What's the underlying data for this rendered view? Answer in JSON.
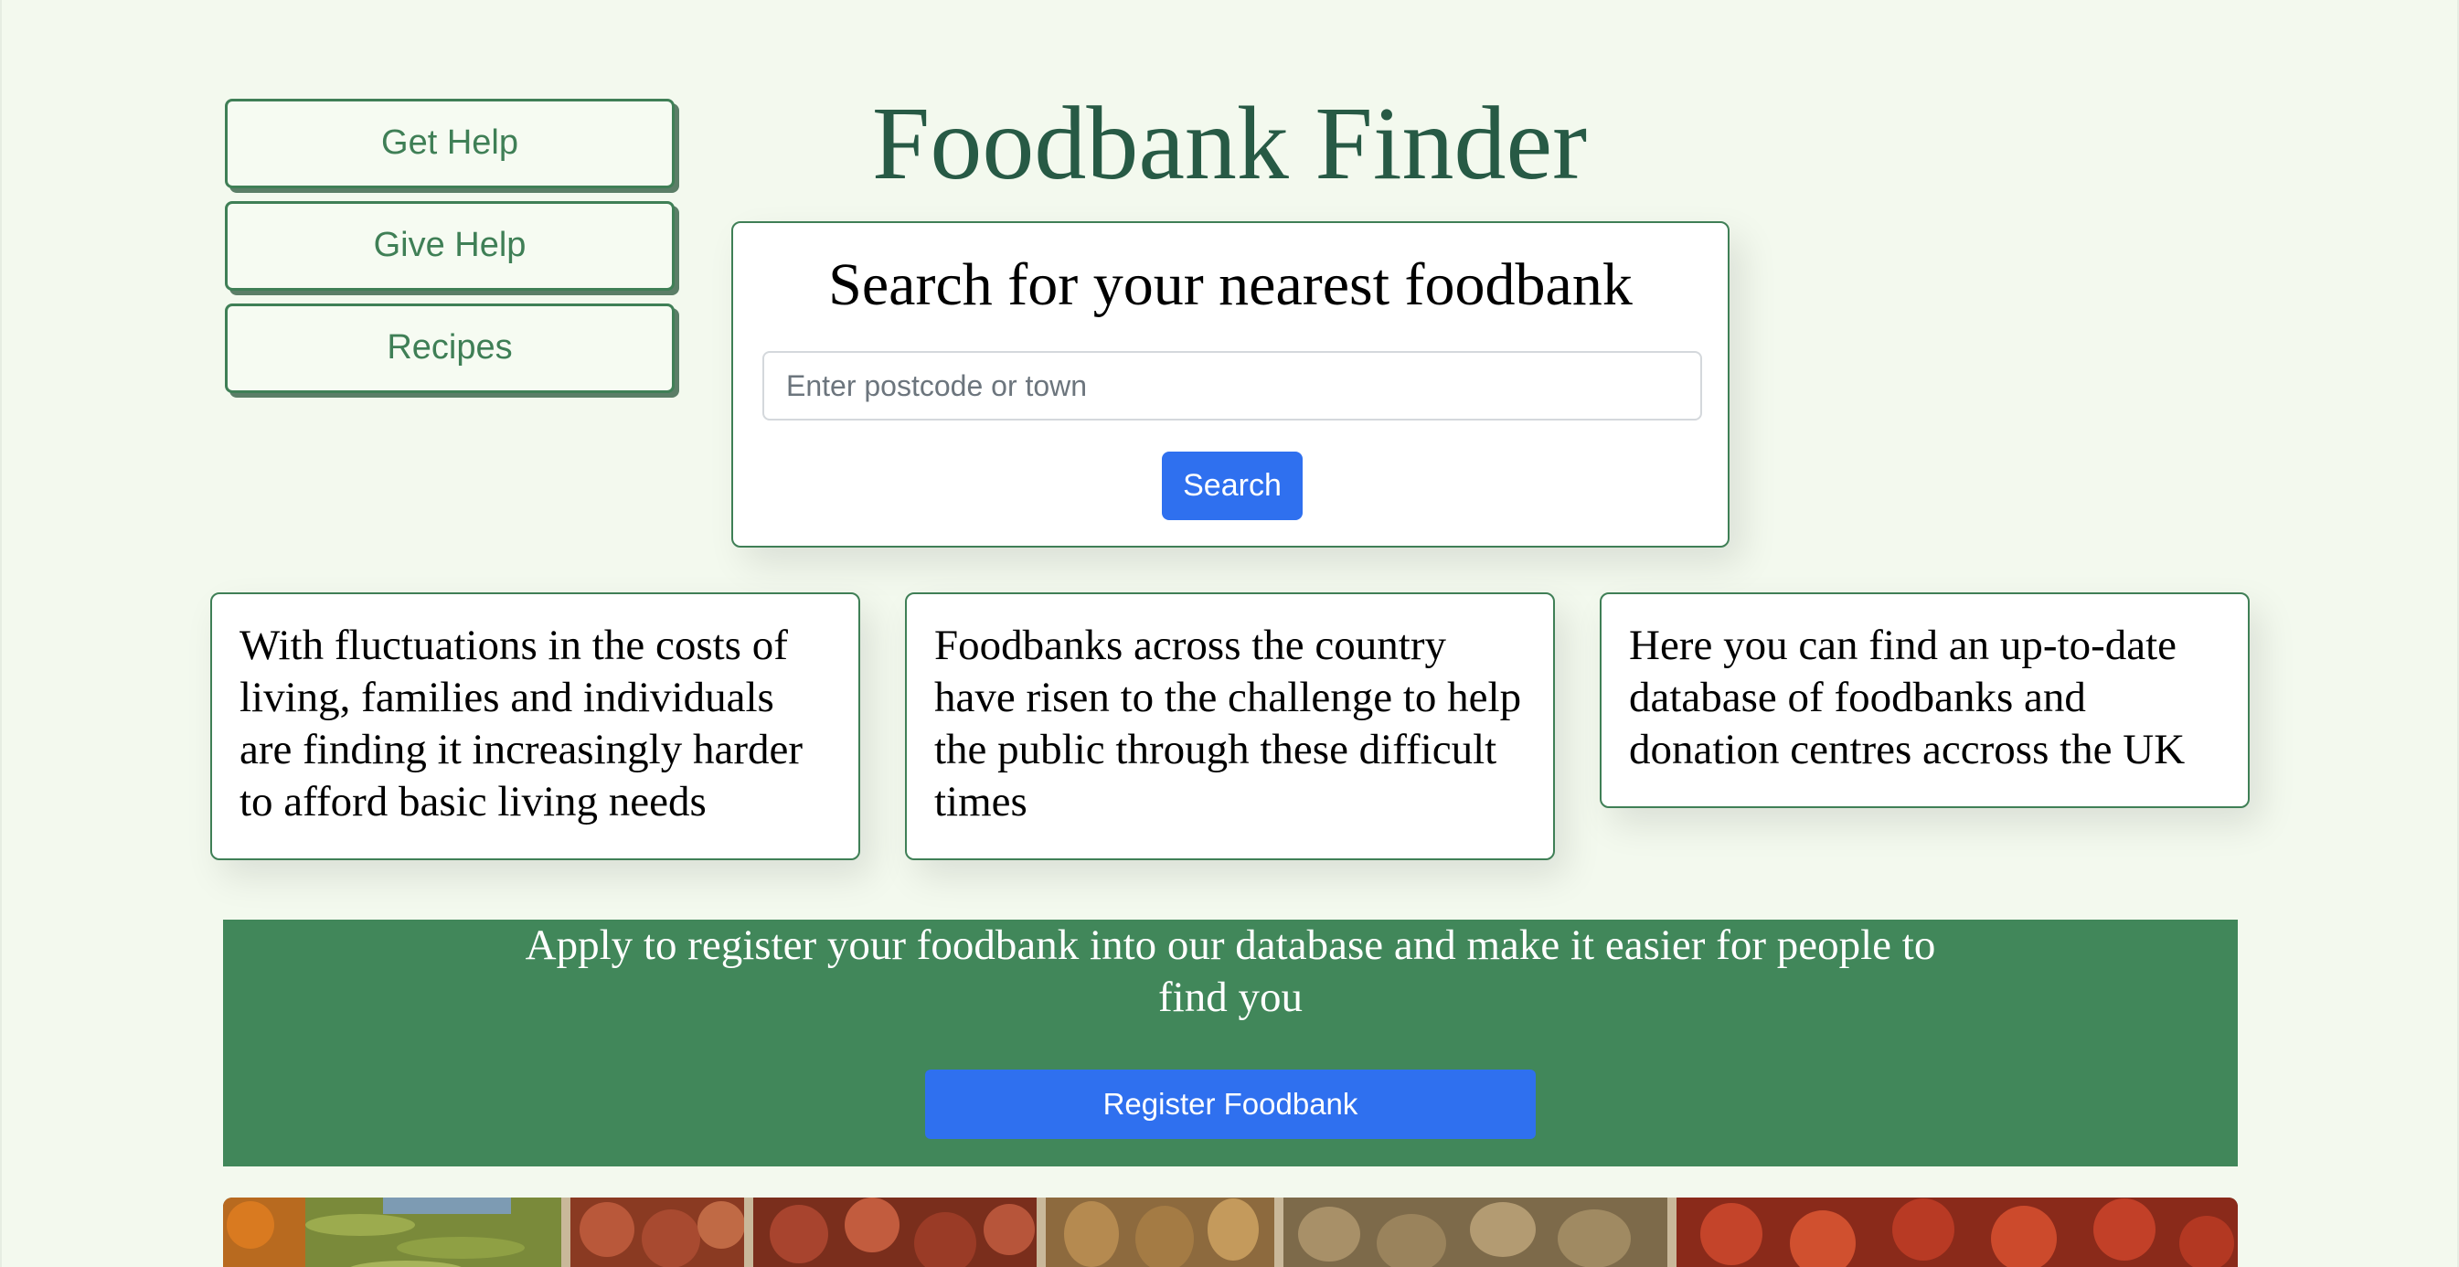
{
  "header": {
    "title": "Foodbank Finder"
  },
  "nav": {
    "items": [
      {
        "label": "Get Help"
      },
      {
        "label": "Give Help"
      },
      {
        "label": "Recipes"
      }
    ]
  },
  "search": {
    "heading": "Search for your nearest foodbank",
    "placeholder": "Enter postcode or town",
    "value": "",
    "button_label": "Search"
  },
  "info_cards": [
    {
      "text": "With fluctuations in the costs of living, families and individuals are finding it increasingly harder to afford basic living needs"
    },
    {
      "text": "Foodbanks across the country have risen to the challenge to help the public through these difficult times"
    },
    {
      "text": "Here you can find an up-to-date database of foodbanks and donation centres accross the UK"
    }
  ],
  "register": {
    "text": "Apply to register your foodbank into our database and make it easier for people to find you",
    "button_label": "Register Foodbank"
  },
  "colors": {
    "background": "#f3f9ee",
    "brand_green": "#3f7f56",
    "band_green": "#41875a",
    "title_green": "#275a45",
    "primary_blue": "#2f70ef"
  }
}
